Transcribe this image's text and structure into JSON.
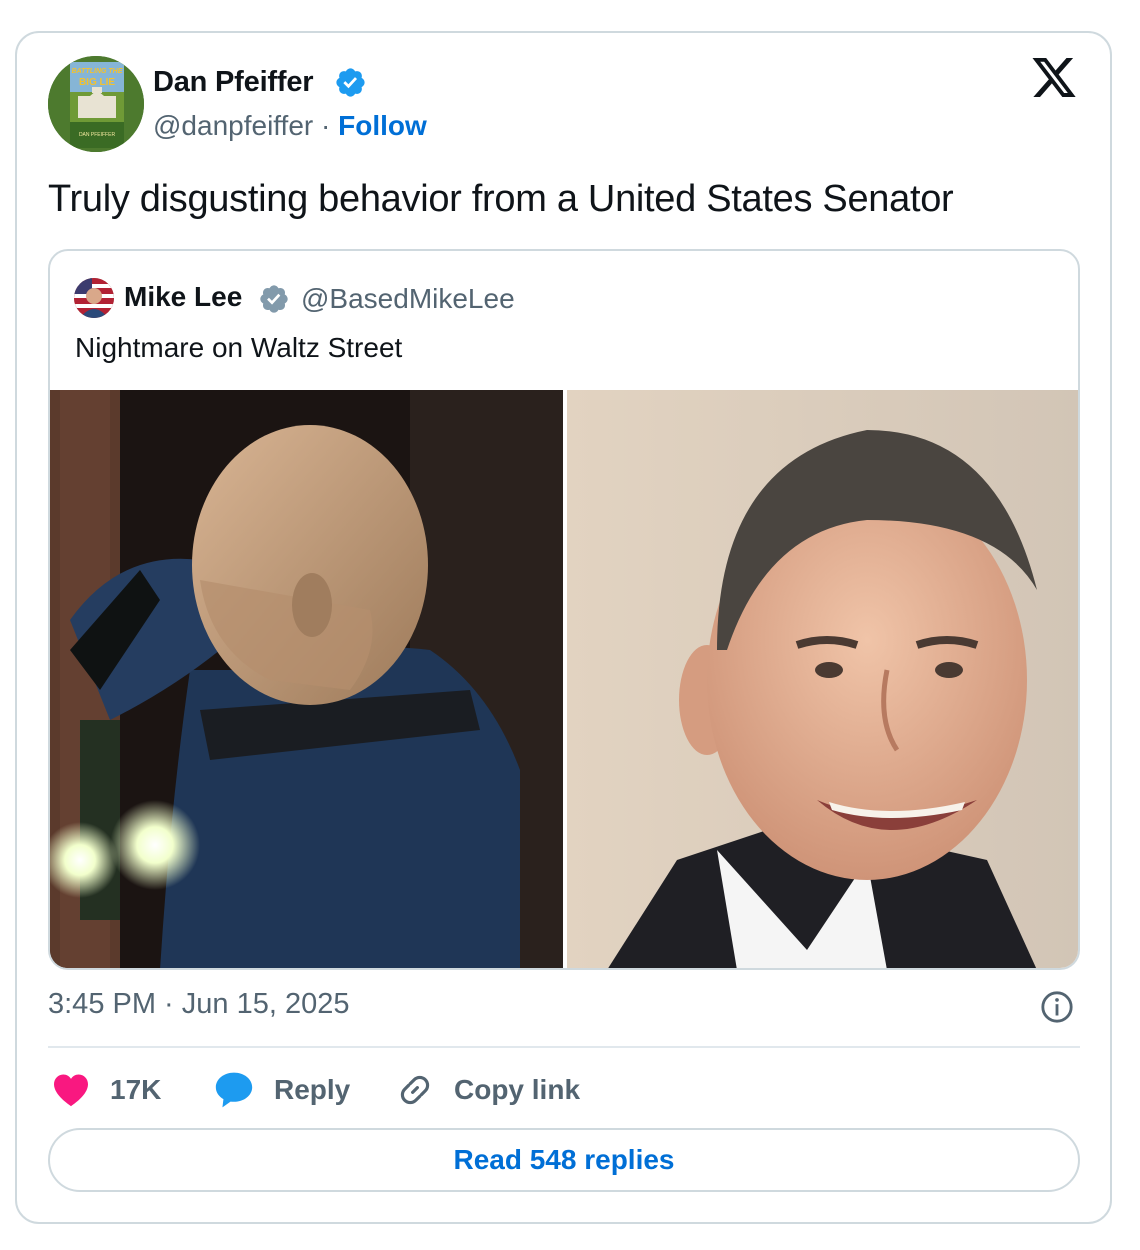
{
  "author": {
    "name": "Dan Pfeiffer",
    "handle": "@danpfeiffer",
    "separator": " · ",
    "follow_label": "Follow",
    "avatar_text": [
      "BATTLING THE",
      "BIG LIE",
      "DAN PFEIFFER"
    ]
  },
  "tweet": {
    "text": "Truly disgusting behavior from a United States Senator",
    "timestamp": "3:45 PM · Jun 15, 2025"
  },
  "quoted_tweet": {
    "name": "Mike Lee",
    "handle": "@BasedMikeLee",
    "text": "Nightmare on Waltz Street"
  },
  "actions": {
    "like_count": "17K",
    "reply_label": "Reply",
    "copy_label": "Copy link",
    "read_replies_label": "Read 548 replies"
  },
  "colors": {
    "link_blue": "#006fd6",
    "verified_blue": "#1d9bf0",
    "verified_gray": "#829aab",
    "like_pink": "#f91880",
    "muted_text": "#536471",
    "border": "#cfd9de"
  },
  "icons": [
    "verified-badge-icon",
    "x-logo-icon",
    "info-icon",
    "heart-icon",
    "reply-bubble-icon",
    "link-icon"
  ]
}
